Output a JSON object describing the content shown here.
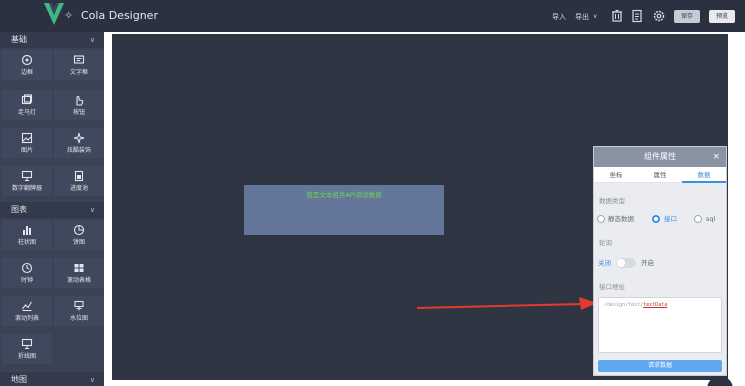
{
  "header": {
    "brand": "Cola Designer",
    "menu": {
      "import": "导入",
      "export": "导出"
    },
    "buttons": {
      "save": "保存",
      "preview": "预览"
    }
  },
  "sidebar": {
    "sections": [
      {
        "title": "基础",
        "items": [
          {
            "label": "边框",
            "icon": "border-icon"
          },
          {
            "label": "文字框",
            "icon": "text-icon"
          },
          {
            "label": "走马灯",
            "icon": "marquee-icon"
          },
          {
            "label": "按钮",
            "icon": "button-icon"
          },
          {
            "label": "图片",
            "icon": "image-icon"
          },
          {
            "label": "炫酷装饰",
            "icon": "decoration-icon"
          },
          {
            "label": "数字翻牌器",
            "icon": "flipper-icon"
          },
          {
            "label": "进度池",
            "icon": "progress-icon"
          }
        ]
      },
      {
        "title": "图表",
        "items": [
          {
            "label": "柱状图",
            "icon": "bar-chart-icon"
          },
          {
            "label": "饼图",
            "icon": "pie-chart-icon"
          },
          {
            "label": "时钟",
            "icon": "clock-icon"
          },
          {
            "label": "滚动表格",
            "icon": "table-icon"
          },
          {
            "label": "滚动列表",
            "icon": "list-icon"
          },
          {
            "label": "水位图",
            "icon": "water-icon"
          },
          {
            "label": "折线图",
            "icon": "line-chart-icon"
          }
        ]
      },
      {
        "title": "地图"
      }
    ]
  },
  "canvas": {
    "widget_text": "我是文本组件API测试数据"
  },
  "panel": {
    "title": "组件属性",
    "close": "×",
    "tabs": [
      "坐标",
      "属性",
      "数据"
    ],
    "active_tab": "数据",
    "data_type_label": "数据类型",
    "data_type_options": [
      "静态数据",
      "接口",
      "sql"
    ],
    "data_type_selected": "接口",
    "polling_label": "轮询",
    "polling_off": "关闭",
    "polling_on": "开启",
    "api_label": "接口地址",
    "api_prefix": "/design/test/",
    "api_highlight": "textData",
    "request_button": "请求数据"
  },
  "colors": {
    "topbar": "#2b3141",
    "sidebar": "#3a4255",
    "canvas": "#2f3542",
    "accent": "#3a8ee6",
    "widget_text": "#6fd05a",
    "arrow": "#e23b2e"
  }
}
